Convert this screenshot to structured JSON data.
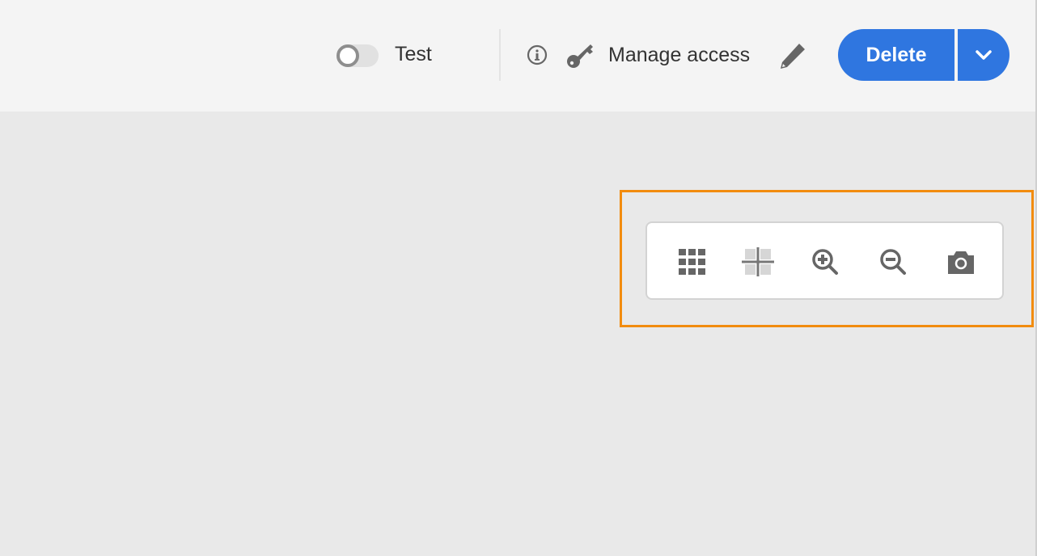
{
  "header": {
    "test_toggle": {
      "label": "Test",
      "on": false
    },
    "info_icon": "info-icon",
    "manage_access_label": "Manage access",
    "edit_icon": "pencil-icon",
    "delete_label": "Delete",
    "dropdown_icon": "chevron-down-icon",
    "accent": "#2f76e0"
  },
  "toolbar": {
    "highlight_color": "#f28c0f",
    "tools": [
      "grid-icon",
      "crosshair-icon",
      "zoom-in-icon",
      "zoom-out-icon",
      "camera-icon"
    ]
  }
}
